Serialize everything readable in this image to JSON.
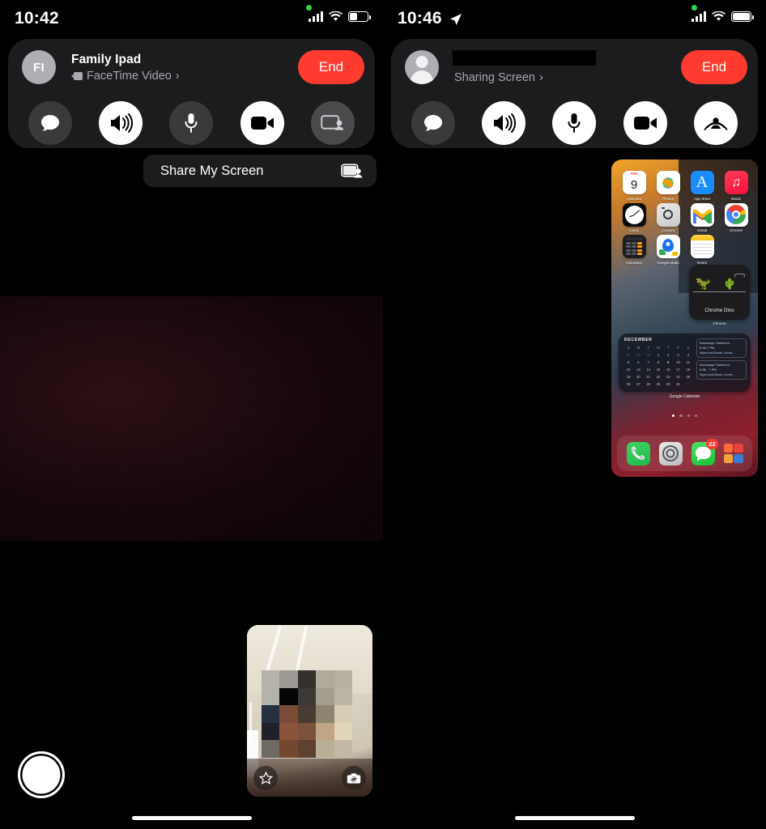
{
  "left_panel": {
    "status_bar": {
      "time": "10:42",
      "signal_icon": "cellular-bars-icon",
      "wifi_icon": "wifi-icon",
      "battery_icon": "battery-icon",
      "battery_level_pct": 42,
      "recording_indicator": "green-privacy-dot"
    },
    "call_card": {
      "avatar_initials": "FI",
      "caller_name": "Family Ipad",
      "call_type": "FaceTime Video",
      "call_type_icon": "video-camera-icon",
      "disclosure_icon": "chevron-right-icon",
      "end_label": "End",
      "end_color": "#ff3b30",
      "controls": [
        {
          "name": "messages-button",
          "icon": "speech-bubble-icon",
          "state": "dim"
        },
        {
          "name": "speaker-button",
          "icon": "speaker-waves-icon",
          "state": "active"
        },
        {
          "name": "mute-button",
          "icon": "microphone-icon",
          "state": "dim"
        },
        {
          "name": "camera-button",
          "icon": "video-camera-icon",
          "state": "active"
        },
        {
          "name": "share-screen-button",
          "icon": "screen-share-person-icon",
          "state": "dim2"
        }
      ]
    },
    "share_menu": {
      "label": "Share My Screen",
      "icon": "screen-share-person-icon"
    },
    "remote_video": {
      "name": "remote-video-feed",
      "description": "very dark near-black video feed"
    },
    "self_view": {
      "name": "self-view-pip",
      "effects_icon": "star-effects-icon",
      "flip_icon": "camera-flip-icon",
      "privacy": "face-pixelated"
    },
    "shutter_button_icon": "shutter-capture-icon",
    "home_indicator": "home-indicator-bar"
  },
  "right_panel": {
    "status_bar": {
      "time": "10:46",
      "location_icon": "location-arrow-icon",
      "signal_icon": "cellular-bars-icon",
      "wifi_icon": "wifi-icon",
      "battery_icon": "battery-icon",
      "battery_level_pct": 100,
      "recording_indicator": "green-privacy-dot"
    },
    "call_card": {
      "avatar_icon": "person-silhouette-icon",
      "caller_name_redacted": true,
      "call_status": "Sharing Screen",
      "disclosure_icon": "chevron-right-icon",
      "end_label": "End",
      "end_color": "#ff3b30",
      "controls": [
        {
          "name": "messages-button",
          "icon": "speech-bubble-icon",
          "state": "dim"
        },
        {
          "name": "speaker-button",
          "icon": "speaker-waves-icon",
          "state": "active"
        },
        {
          "name": "mute-button",
          "icon": "microphone-icon",
          "state": "active"
        },
        {
          "name": "camera-button",
          "icon": "video-camera-icon",
          "state": "active"
        },
        {
          "name": "sharing-screen-active-button",
          "icon": "screen-broadcast-person-icon",
          "state": "active"
        }
      ]
    },
    "remote_video": {
      "name": "remote-participant-tile",
      "avatar_icon": "person-circle-avatar",
      "avatar_color": "#4ecff2",
      "name_redacted": true
    },
    "self_view": {
      "name": "self-view-pip",
      "effects_icon": "star-effects-icon",
      "flip_icon": "camera-flip-icon",
      "privacy": "face-pixelated"
    },
    "home_indicator": "home-indicator-bar"
  },
  "shared_screen": {
    "title": "mirrored-iphone-home-screen",
    "apps": [
      {
        "name": "Calendar",
        "icon": "calendar-icon",
        "cal_dow": "THU",
        "cal_day": "9"
      },
      {
        "name": "Photos",
        "icon": "photos-icon"
      },
      {
        "name": "App Store",
        "icon": "app-store-icon"
      },
      {
        "name": "Music",
        "icon": "music-icon"
      },
      {
        "name": "Clock",
        "icon": "clock-icon"
      },
      {
        "name": "Camera",
        "icon": "camera-icon"
      },
      {
        "name": "Gmail",
        "icon": "gmail-icon"
      },
      {
        "name": "Chrome",
        "icon": "chrome-icon"
      },
      {
        "name": "Calculator",
        "icon": "calculator-icon"
      },
      {
        "name": "Google Maps",
        "icon": "google-maps-icon"
      },
      {
        "name": "Notes",
        "icon": "notes-icon"
      }
    ],
    "dino_widget": {
      "label": "Chrome Dino",
      "app_label": "Chrome",
      "dino_icon": "t-rex-icon",
      "cactus_icon": "cactus-icon",
      "cloud_icon": "cloud-icon"
    },
    "calendar_widget": {
      "month": "DECEMBER",
      "dow": [
        "S",
        "M",
        "T",
        "W",
        "T",
        "F",
        "S"
      ],
      "lead_out_days": [
        28,
        29,
        30
      ],
      "days": [
        1,
        2,
        3,
        4,
        5,
        6,
        7,
        8,
        9,
        10,
        11,
        12,
        13,
        14,
        15,
        16,
        17,
        18,
        19,
        20,
        21,
        22,
        23,
        24,
        25,
        26,
        27,
        28,
        29,
        30,
        31
      ],
      "today": 9,
      "today_color": "#1a73e8",
      "trail_out_days": [
        1
      ],
      "events": [
        {
          "title": "Backstage Taskforce...",
          "time": "6:38-7 PM",
          "link": "https://us02web..zoom..."
        },
        {
          "title": "Backstage Taskforce...",
          "time": "6:38 - 7 PM",
          "link": "https://us02web..zoom..."
        }
      ],
      "widget_label": "Google Calendar"
    },
    "page_dots": {
      "count": 4,
      "active_index": 0
    },
    "dock": [
      {
        "name": "Phone",
        "icon": "phone-icon",
        "badge": null
      },
      {
        "name": "Settings",
        "icon": "settings-gear-icon",
        "badge": null
      },
      {
        "name": "Messages",
        "icon": "messages-icon",
        "badge": "22"
      },
      {
        "name": "Shortcuts",
        "icon": "shortcuts-grid-icon",
        "badge": null
      }
    ]
  }
}
